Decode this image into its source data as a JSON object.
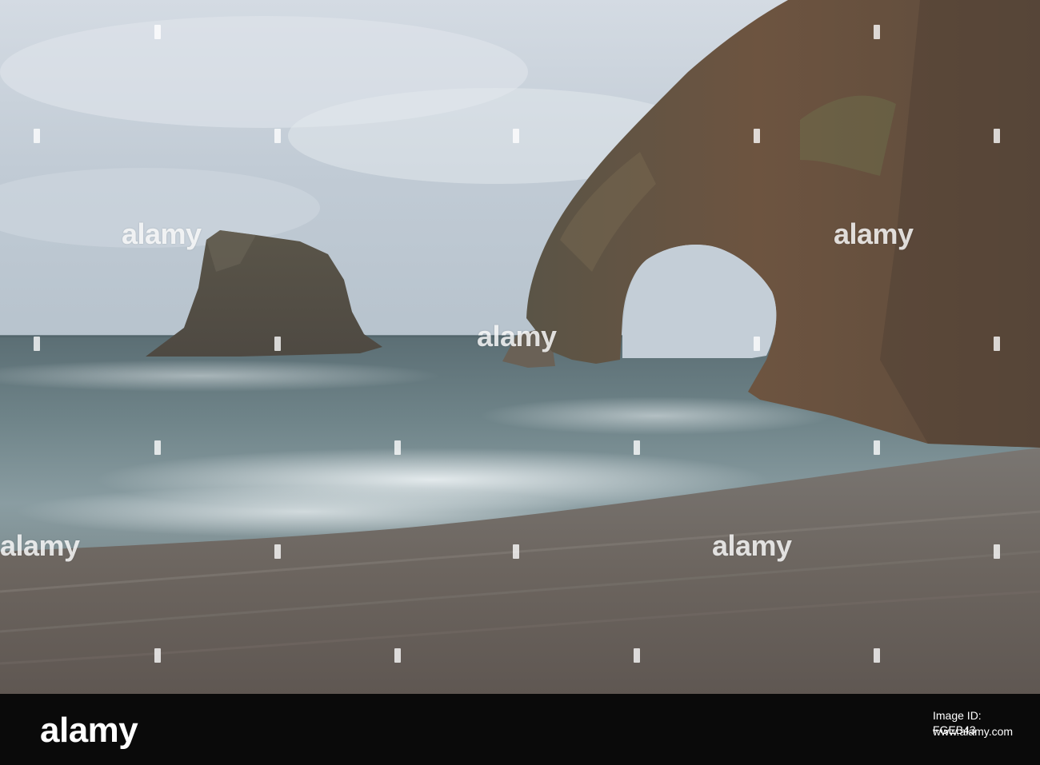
{
  "photo": {
    "subject": "sea-arch-and-sea-stack-beach"
  },
  "watermark": {
    "text": "alamy"
  },
  "footer": {
    "logo_text": "alamy",
    "image_id": "Image ID: FGEB43",
    "url": "www.alamy.com"
  },
  "colors": {
    "footer_bg": "#0a0a0a",
    "sky_top": "#c9d2db",
    "sea": "#5f7378",
    "sand": "#6e6762",
    "rock": "#6a5040"
  }
}
